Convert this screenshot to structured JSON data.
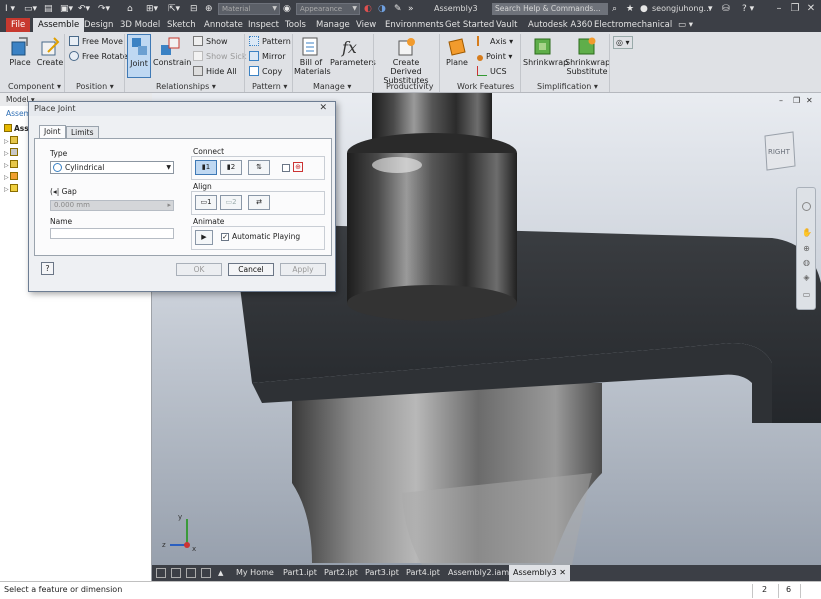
{
  "title_bar": {
    "app_title": "Assembly3",
    "material_combo": "Material",
    "appearance_combo": "Appearance",
    "search_placeholder": "Search Help & Commands...",
    "user_name": "seongjuhong...",
    "help_label": "?"
  },
  "ribbon_tabs": [
    "File",
    "Assemble",
    "Design",
    "3D Model",
    "Sketch",
    "Annotate",
    "Inspect",
    "Tools",
    "Manage",
    "View",
    "Environments",
    "Get Started",
    "Vault",
    "Autodesk A360",
    "Electromechanical"
  ],
  "ribbon": {
    "component": {
      "place": "Place",
      "create": "Create",
      "label": "Component"
    },
    "position": {
      "free_move": "Free Move",
      "free_rotate": "Free Rotate",
      "label": "Position"
    },
    "relationships": {
      "joint": "Joint",
      "constrain": "Constrain",
      "show": "Show",
      "show_sick": "Show Sick",
      "hide_all": "Hide All",
      "label": "Relationships"
    },
    "pattern": {
      "pattern": "Pattern",
      "mirror": "Mirror",
      "copy": "Copy",
      "label": "Pattern"
    },
    "manage": {
      "bom_line1": "Bill of",
      "bom_line2": "Materials",
      "parameters": "Parameters",
      "label": "Manage"
    },
    "productivity": {
      "derived_line1": "Create Derived",
      "derived_line2": "Substitutes",
      "label": "Productivity"
    },
    "work_features": {
      "plane": "Plane",
      "axis": "Axis",
      "point": "Point",
      "ucs": "UCS",
      "label": "Work Features"
    },
    "simplification": {
      "shrinkwrap": "Shrinkwrap",
      "shrinkwrap_sub_line1": "Shrinkwrap",
      "shrinkwrap_sub_line2": "Substitute",
      "label": "Simplification"
    }
  },
  "browser": {
    "header": "Model",
    "assembly_prefix": "Assem",
    "tree_root": "Ass"
  },
  "dialog": {
    "title": "Place Joint",
    "tabs": [
      "Joint",
      "Limits"
    ],
    "type_label": "Type",
    "type_value": "Cylindrical",
    "gap_label": "Gap",
    "gap_value": "0.000 mm",
    "name_label": "Name",
    "connect_label": "Connect",
    "connect_1": "1",
    "connect_2": "2",
    "align_label": "Align",
    "align_1": "1",
    "align_2": "2",
    "animate_label": "Animate",
    "auto_play_label": "Automatic Playing",
    "ok": "OK",
    "cancel": "Cancel",
    "apply": "Apply"
  },
  "viewcube": {
    "face": "RIGHT"
  },
  "doc_tabs": [
    "My Home",
    "Part1.ipt",
    "Part2.ipt",
    "Part3.ipt",
    "Part4.ipt",
    "Assembly2.iam",
    "Assembly3"
  ],
  "status": {
    "message": "Select a feature or dimension",
    "count1": "2",
    "count2": "6"
  },
  "colors": {
    "file_tab": "#c7392f",
    "chrome": "#3c3f46",
    "ribbon_bg": "#dfe1e5",
    "selected_button": "#bfd8f2"
  }
}
